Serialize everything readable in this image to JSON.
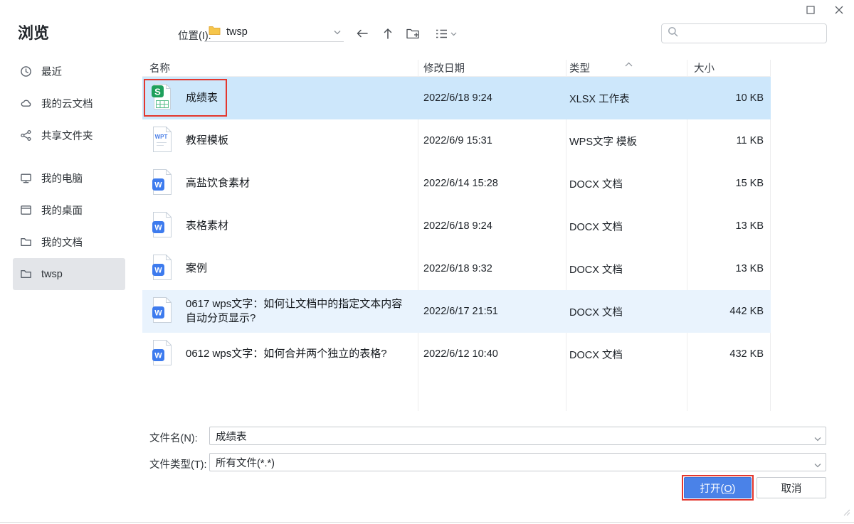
{
  "window": {
    "title": "浏览"
  },
  "toolbar": {
    "location_label": "位置(I):",
    "location_value": "twsp"
  },
  "sidebar": {
    "items": [
      {
        "id": "recent",
        "label": "最近",
        "icon": "clock"
      },
      {
        "id": "cloud-docs",
        "label": "我的云文档",
        "icon": "cloud"
      },
      {
        "id": "shared-folder",
        "label": "共享文件夹",
        "icon": "share"
      },
      {
        "id": "my-computer",
        "label": "我的电脑",
        "icon": "computer",
        "gap": true
      },
      {
        "id": "my-desktop",
        "label": "我的桌面",
        "icon": "desktop"
      },
      {
        "id": "my-documents",
        "label": "我的文档",
        "icon": "folder"
      },
      {
        "id": "twsp",
        "label": "twsp",
        "icon": "folder",
        "selected": true
      }
    ]
  },
  "file_list": {
    "columns": [
      "名称",
      "修改日期",
      "类型",
      "大小"
    ],
    "rows": [
      {
        "name": "成绩表",
        "icon": "xlsx",
        "date": "2022/6/18 9:24",
        "type": "XLSX 工作表",
        "size": "10 KB",
        "selected": true,
        "annotated": true
      },
      {
        "name": "教程模板",
        "icon": "wpt",
        "date": "2022/6/9 15:31",
        "type": "WPS文字 模板",
        "size": "11 KB"
      },
      {
        "name": "高盐饮食素材",
        "icon": "docx",
        "date": "2022/6/14 15:28",
        "type": "DOCX 文档",
        "size": "15 KB"
      },
      {
        "name": "表格素材",
        "icon": "docx",
        "date": "2022/6/18 9:24",
        "type": "DOCX 文档",
        "size": "13 KB"
      },
      {
        "name": "案例",
        "icon": "docx",
        "date": "2022/6/18 9:32",
        "type": "DOCX 文档",
        "size": "13 KB"
      },
      {
        "name": "0617 wps文字：如何让文档中的指定文本内容自动分页显示?",
        "icon": "docx",
        "date": "2022/6/17 21:51",
        "type": "DOCX 文档",
        "size": "442 KB",
        "tinted": true
      },
      {
        "name": "0612 wps文字：如何合并两个独立的表格?",
        "icon": "docx",
        "date": "2022/6/12 10:40",
        "type": "DOCX 文档",
        "size": "432 KB"
      }
    ]
  },
  "footer": {
    "filename_label": "文件名(N):",
    "filename_value": "成绩表",
    "filetype_label": "文件类型(T):",
    "filetype_value": "所有文件(*.*)",
    "open_prefix": "打开(",
    "open_key": "O",
    "open_suffix": ")",
    "cancel_button": "取消"
  },
  "colors": {
    "accent_blue": "#4a82e8",
    "selected_row": "#cde7fb",
    "tinted_row": "#e9f3fd",
    "annotation_red": "#e3372e",
    "sidebar_selected": "#e3e5e9"
  }
}
